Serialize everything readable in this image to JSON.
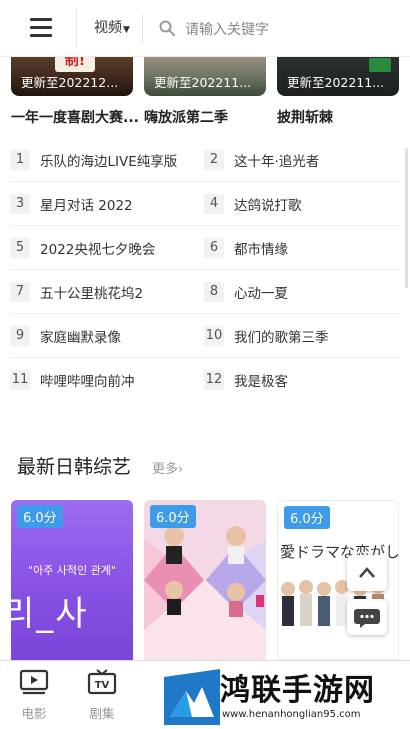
{
  "header": {
    "category": "视频",
    "search_placeholder": "请输入关键字"
  },
  "top_cards": [
    {
      "update": "更新至202212...",
      "title": "一年一度喜剧大赛..."
    },
    {
      "update": "更新至202211...",
      "title": "嗨放派第二季"
    },
    {
      "update": "更新至202211...",
      "title": "披荆斩棘"
    }
  ],
  "ranking": [
    {
      "num": "1",
      "name": "乐队的海边LIVE纯享版"
    },
    {
      "num": "2",
      "name": "这十年·追光者"
    },
    {
      "num": "3",
      "name": "星月对话 2022"
    },
    {
      "num": "4",
      "name": "达鸽说打歌"
    },
    {
      "num": "5",
      "name": "2022央视七夕晚会"
    },
    {
      "num": "6",
      "name": "都市情缘"
    },
    {
      "num": "7",
      "name": "五十公里桃花坞2"
    },
    {
      "num": "8",
      "name": "心动一夏"
    },
    {
      "num": "9",
      "name": "家庭幽默录像"
    },
    {
      "num": "10",
      "name": "我们的歌第三季"
    },
    {
      "num": "11",
      "name": "哔哩哔哩向前冲"
    },
    {
      "num": "12",
      "name": "我是极客"
    }
  ],
  "section": {
    "title": "最新日韩综艺",
    "more": "更多›"
  },
  "latest_cards": [
    {
      "score": "6.0分",
      "poster_text": "\"아주 사적인 관계\"",
      "poster_big": "리_사"
    },
    {
      "score": "6.0分"
    },
    {
      "score": "6.0分",
      "poster_text": "愛ドラマな恋がした"
    }
  ],
  "tabs": [
    {
      "label": "电影",
      "icon": "movie-icon"
    },
    {
      "label": "剧集",
      "icon": "tv-icon"
    }
  ],
  "watermark": {
    "title": "鸿联手游网",
    "url": "www.henanhonglian95.com"
  },
  "colors": {
    "score_badge": "#3d9be9",
    "purple_poster": "#8a52e6"
  }
}
